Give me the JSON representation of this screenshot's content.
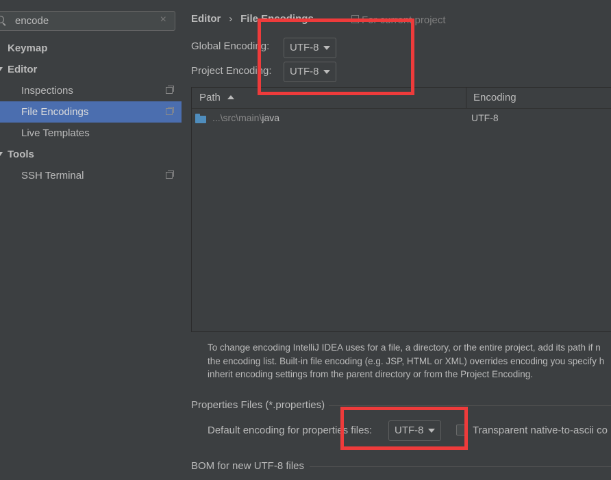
{
  "search": {
    "value": "encode",
    "clear_glyph": "×",
    "icon": "search-icon"
  },
  "sidebar": {
    "items": [
      {
        "label": "Keymap",
        "kind": "group"
      },
      {
        "label": "Editor",
        "kind": "group-expanded"
      },
      {
        "label": "Inspections",
        "kind": "child",
        "project_icon": true
      },
      {
        "label": "File Encodings",
        "kind": "child",
        "selected": true,
        "project_icon": true
      },
      {
        "label": "Live Templates",
        "kind": "child"
      },
      {
        "label": "Tools",
        "kind": "group-expanded"
      },
      {
        "label": "SSH Terminal",
        "kind": "child",
        "project_icon": true
      }
    ]
  },
  "header": {
    "breadcrumb_1": "Editor",
    "separator": "›",
    "breadcrumb_2": "File Encodings",
    "scope_note": "For current project"
  },
  "encodings": {
    "global_label": "Global Encoding:",
    "global_value": "UTF-8",
    "project_label": "Project Encoding:",
    "project_value": "UTF-8"
  },
  "table": {
    "columns": [
      "Path",
      "Encoding"
    ],
    "rows": [
      {
        "path_prefix": "...\\src\\main\\",
        "path_name": "java",
        "encoding": "UTF-8"
      }
    ]
  },
  "help_text": [
    "To change encoding IntelliJ IDEA uses for a file, a directory, or the entire project, add its path if n",
    "the encoding list. Built-in file encoding (e.g. JSP, HTML or XML) overrides encoding you specify h",
    "inherit encoding settings from the parent directory or from the Project Encoding."
  ],
  "properties": {
    "section_title": "Properties Files (*.properties)",
    "default_label": "Default encoding for properties files:",
    "default_value": "UTF-8",
    "transparent_label": "Transparent native-to-ascii co",
    "transparent_checked": false
  },
  "bom": {
    "section_title": "BOM for new UTF-8 files"
  },
  "colors": {
    "background": "#3c3f41",
    "selection": "#4b6eaf",
    "highlight_box": "#ee3b3b",
    "folder": "#4f8dbd"
  }
}
